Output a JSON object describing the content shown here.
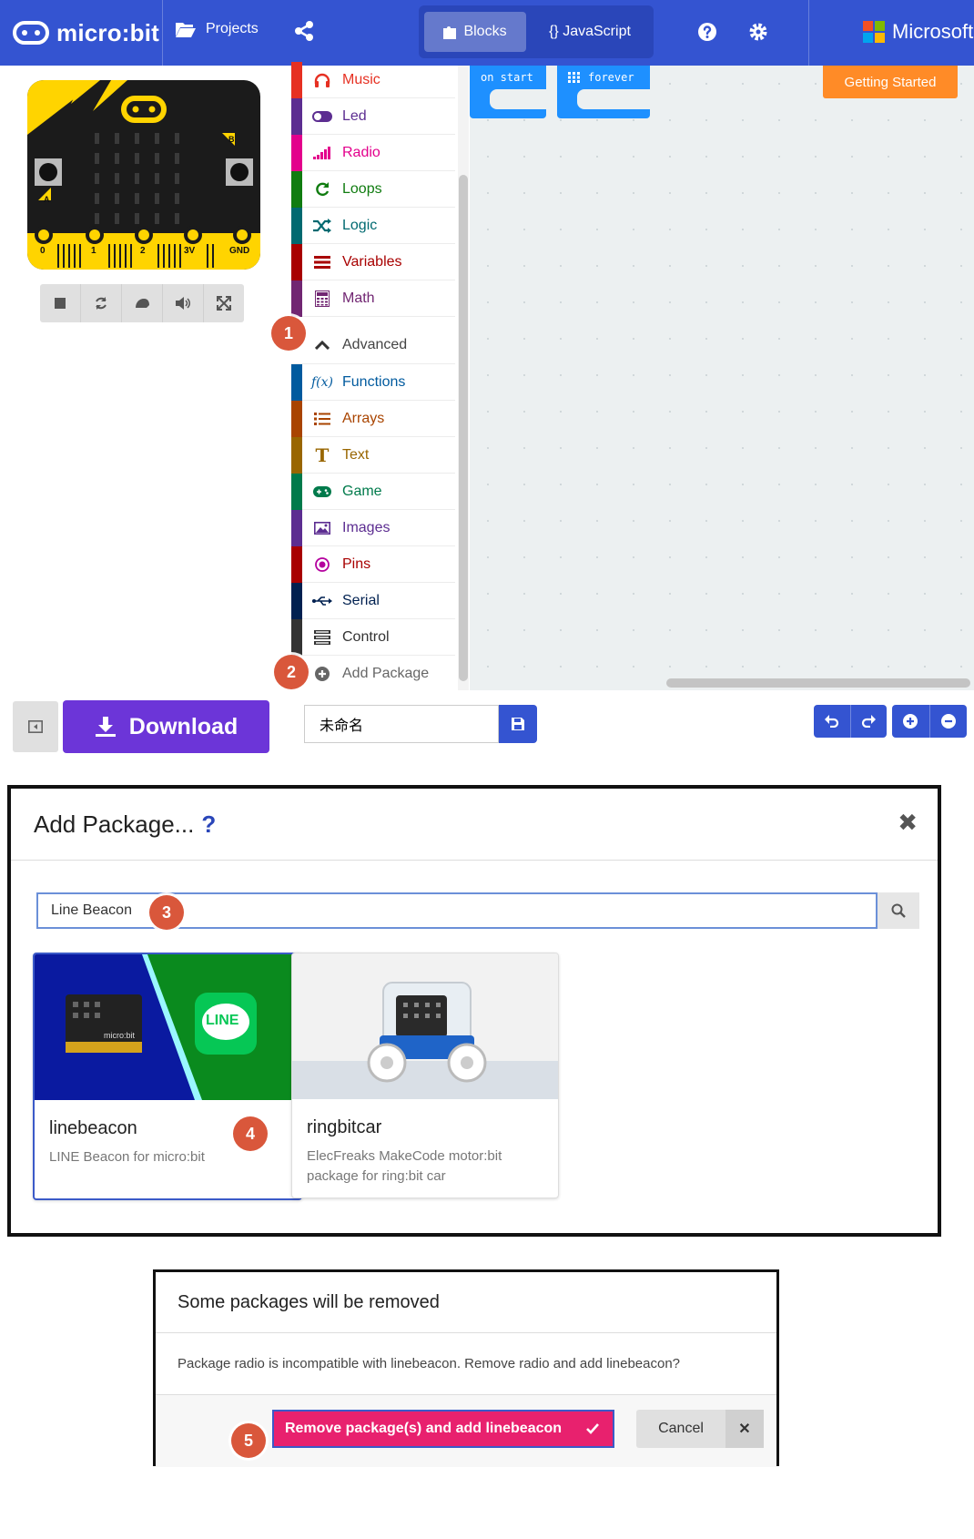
{
  "header": {
    "brand": "micro:bit",
    "projects_label": "Projects",
    "mode_blocks": "Blocks",
    "mode_javascript": "{} JavaScript",
    "microsoft_label": "Microsoft",
    "color": "#3454D1"
  },
  "simulator": {
    "pin_labels": [
      "0",
      "1",
      "2",
      "3V",
      "GND"
    ],
    "button_a": "A",
    "button_b": "B",
    "controls": [
      "stop-icon",
      "restart-icon",
      "slowmo-icon",
      "mute-icon",
      "fullscreen-icon"
    ]
  },
  "toolbox": {
    "categories": [
      {
        "label": "Music",
        "color": "#E63022",
        "icon": "headphones-icon"
      },
      {
        "label": "Led",
        "color": "#5C2D91",
        "icon": "toggle-icon"
      },
      {
        "label": "Radio",
        "color": "#E3008C",
        "icon": "signal-icon"
      },
      {
        "label": "Loops",
        "color": "#107C10",
        "icon": "refresh-icon"
      },
      {
        "label": "Logic",
        "color": "#006970",
        "icon": "shuffle-icon"
      },
      {
        "label": "Variables",
        "color": "#A80000",
        "icon": "list-icon"
      },
      {
        "label": "Math",
        "color": "#712672",
        "icon": "calculator-icon"
      }
    ],
    "advanced_label": "Advanced",
    "advanced_categories": [
      {
        "label": "Functions",
        "color": "#005A9E",
        "icon": "function-icon"
      },
      {
        "label": "Arrays",
        "color": "#A94400",
        "icon": "list-ordered-icon"
      },
      {
        "label": "Text",
        "color": "#996600",
        "icon": "text-icon"
      },
      {
        "label": "Game",
        "color": "#007A4B",
        "icon": "gamepad-icon"
      },
      {
        "label": "Images",
        "color": "#5C2D91",
        "icon": "image-icon"
      },
      {
        "label": "Pins",
        "color": "#B4009E",
        "icon": "pins-icon"
      },
      {
        "label": "Serial",
        "color": "#002050",
        "icon": "usb-icon"
      },
      {
        "label": "Control",
        "color": "#333333",
        "icon": "control-icon"
      }
    ],
    "add_package_label": "Add Package"
  },
  "workspace": {
    "blocks": [
      "on start",
      "forever"
    ],
    "getting_started_label": "Getting Started"
  },
  "bottom": {
    "download_label": "Download",
    "project_name": "未命名"
  },
  "add_package_dialog": {
    "title": "Add Package...",
    "help": "?",
    "search_value": "Line Beacon",
    "packages": [
      {
        "name": "linebeacon",
        "description": "LINE Beacon for micro:bit",
        "badge": "LINE",
        "board_label": "micro:bit"
      },
      {
        "name": "ringbitcar",
        "description": "ElecFreaks MakeCode motor:bit package for ring:bit car"
      }
    ]
  },
  "confirm_dialog": {
    "title": "Some packages will be removed",
    "message": "Package radio is incompatible with linebeacon. Remove radio and add linebeacon?",
    "confirm_label": "Remove package(s) and add linebeacon",
    "cancel_label": "Cancel"
  },
  "steps": [
    "1",
    "2",
    "3",
    "4",
    "5"
  ]
}
